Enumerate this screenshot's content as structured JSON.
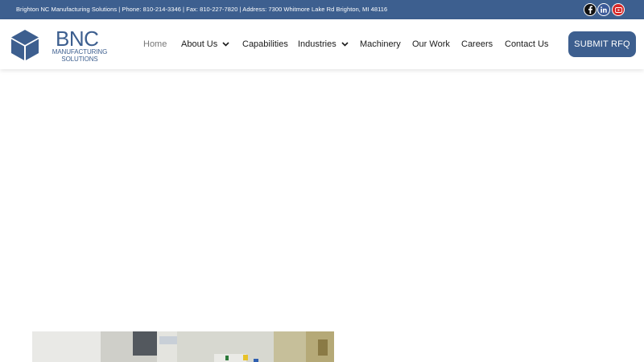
{
  "topbar": {
    "info": "Brighton NC Manufacturing Solutions | Phone: 810-214-3346 | Fax: 810-227-7820 | Address: 7300 Whitmore Lake Rd Brighton, MI 48116",
    "social": [
      {
        "icon": "facebook-icon"
      },
      {
        "icon": "linkedin-icon"
      },
      {
        "icon": "youtube-icon"
      }
    ]
  },
  "logo": {
    "name": "BNC",
    "subtitle_line1": "MANUFACTURING",
    "subtitle_line2": "SOLUTIONS"
  },
  "nav": {
    "home": "Home",
    "about": "About Us",
    "capabilities": "Capabilities",
    "industries": "Industries",
    "machinery": "Machinery",
    "our_work": "Our Work",
    "careers": "Careers",
    "contact": "Contact Us",
    "active": "Home"
  },
  "cta": {
    "rfq_label": "SUBMIT RFQ"
  },
  "colors": {
    "brand": "#3d5f8f",
    "nav_text": "#1a1a1a",
    "nav_active": "#777777"
  }
}
